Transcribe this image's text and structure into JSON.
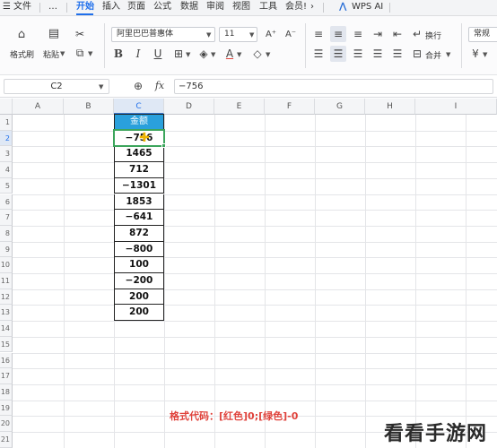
{
  "menubar": {
    "items": [
      "文件",
      "开始",
      "插入",
      "页面",
      "公式",
      "数据",
      "审阅",
      "视图",
      "工具",
      "会员!"
    ],
    "active": "开始",
    "more_label": "…",
    "wps_ai": "WPS AI"
  },
  "ribbon": {
    "format_painter": "格式刷",
    "paste": "粘贴",
    "font_name": "阿里巴巴普惠体",
    "font_size": "11",
    "wrap": "换行",
    "merge": "合并",
    "normal_style": "常规",
    "bold": "B",
    "italic": "I",
    "underline": "U",
    "currency": "¥"
  },
  "formula_bar": {
    "name_box": "C2",
    "fx": "fx",
    "formula": "−756"
  },
  "columns": [
    "A",
    "B",
    "C",
    "D",
    "E",
    "F",
    "G",
    "H",
    "I"
  ],
  "rows": [
    "1",
    "2",
    "3",
    "4",
    "5",
    "6",
    "7",
    "8",
    "9",
    "10",
    "11",
    "12",
    "13",
    "14",
    "15",
    "16",
    "17",
    "18",
    "19",
    "20",
    "21"
  ],
  "table": {
    "header": "金额",
    "values": [
      "−756",
      "1465",
      "712",
      "−1301",
      "1853",
      "−641",
      "872",
      "−800",
      "100",
      "−200",
      "200",
      "200"
    ]
  },
  "annotation": "格式代码：[红色]0;[绿色]-0",
  "watermark": "看看手游网",
  "colors": {
    "accent": "#1f6feb",
    "header_fill": "#2aa0dc",
    "selection": "#3ca55c",
    "annotation": "#e0433c"
  }
}
